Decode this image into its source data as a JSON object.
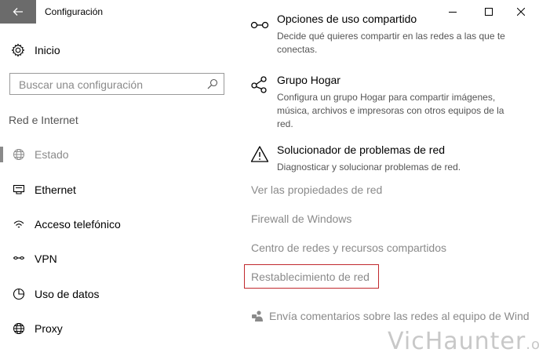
{
  "window": {
    "title": "Configuración"
  },
  "sidebar": {
    "home_label": "Inicio",
    "search_placeholder": "Buscar una configuración",
    "section_title": "Red e Internet",
    "items": [
      {
        "label": "Estado",
        "icon": "globe-icon",
        "selected": true
      },
      {
        "label": "Ethernet",
        "icon": "ethernet-icon"
      },
      {
        "label": "Acceso telefónico",
        "icon": "dialup-icon"
      },
      {
        "label": "VPN",
        "icon": "vpn-icon"
      },
      {
        "label": "Uso de datos",
        "icon": "data-usage-icon"
      },
      {
        "label": "Proxy",
        "icon": "globe-icon"
      }
    ]
  },
  "main": {
    "sharing": {
      "title": "Opciones de uso compartido",
      "desc": "Decide qué quieres compartir en las redes a las que te conectas.",
      "icon": "sharing-icon"
    },
    "homegroup": {
      "title": "Grupo Hogar",
      "desc": "Configura un grupo Hogar para compartir imágenes, música, archivos e impresoras con otros equipos de la red.",
      "icon": "homegroup-icon"
    },
    "troubleshooter": {
      "title": "Solucionador de problemas de red",
      "desc": "Diagnosticar y solucionar problemas de red.",
      "icon": "warning-icon"
    },
    "links": [
      "Ver las propiedades de red",
      "Firewall de Windows",
      "Centro de redes y recursos compartidos",
      "Restablecimiento de red"
    ],
    "feedback": {
      "label": "Envía comentarios sobre las redes al equipo de Wind",
      "icon": "feedback-icon"
    }
  },
  "watermark": {
    "main": "VicHaunter",
    "suffix": ".org"
  },
  "colors": {
    "back_button": "#6b6b6b",
    "highlight_border": "#c0282d",
    "muted_text": "#8a8a8a"
  }
}
